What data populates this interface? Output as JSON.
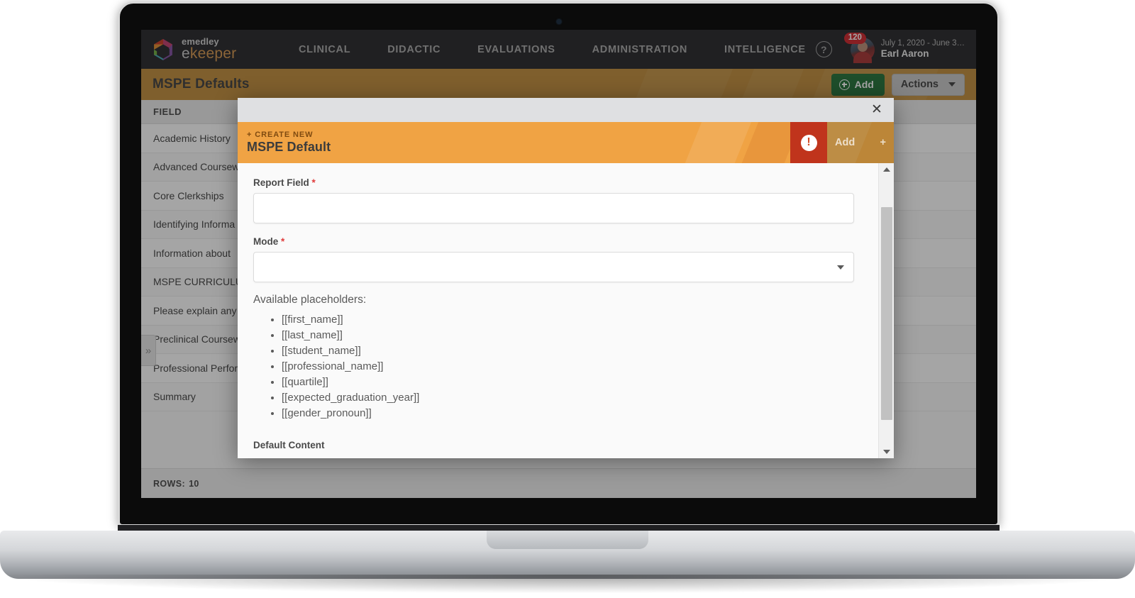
{
  "topnav": {
    "brand": {
      "line1": "emedley",
      "line2_prefix": "e",
      "line2_suffix": "keeper",
      "logo_icon": "hexagon-logo-icon"
    },
    "items": [
      {
        "label": "CLINICAL"
      },
      {
        "label": "DIDACTIC"
      },
      {
        "label": "EVALUATIONS"
      },
      {
        "label": "ADMINISTRATION"
      },
      {
        "label": "INTELLIGENCE"
      }
    ],
    "help_icon": "question-mark-circle-icon",
    "help_glyph": "?",
    "user": {
      "badge_count": "120",
      "date_range": "July 1, 2020 - June 3…",
      "name": "Earl Aaron",
      "avatar_icon": "user-avatar"
    }
  },
  "page_header": {
    "title": "MSPE Defaults",
    "add_label": "Add",
    "add_icon": "plus-circle-icon",
    "actions_label": "Actions",
    "actions_caret_icon": "chevron-down-icon",
    "bg_color": "#c08b38",
    "add_color": "#1f6f34"
  },
  "table": {
    "columns": [
      "FIELD"
    ],
    "rows": [
      {
        "field": "Academic History"
      },
      {
        "field": "Advanced Coursew"
      },
      {
        "field": "Core Clerkships"
      },
      {
        "field": "Identifying Informa"
      },
      {
        "field": "Information about "
      },
      {
        "field": "MSPE CURRICULUM"
      },
      {
        "field": "Please explain any "
      },
      {
        "field": "Preclinical Coursew"
      },
      {
        "field": "Professional Perforn"
      },
      {
        "field": "Summary"
      }
    ],
    "expand_handle_icon": "chevron-double-right-icon",
    "expand_handle_glyph": "»",
    "footer_label": "ROWS:",
    "footer_count": "10"
  },
  "modal": {
    "close_icon": "close-icon",
    "close_glyph": "✕",
    "eyebrow": "+ CREATE NEW",
    "title": "MSPE Default",
    "warning_icon": "exclamation-circle-icon",
    "warning_glyph": "!",
    "add_label": "Add",
    "add_plus_glyph": "+",
    "header_color": "#f0a344",
    "warning_color": "#c0341c",
    "fields": {
      "report_field": {
        "label": "Report Field",
        "required_marker": "*",
        "value": "",
        "placeholder": ""
      },
      "mode": {
        "label": "Mode",
        "required_marker": "*",
        "value": "",
        "placeholder": "",
        "caret_icon": "chevron-down-icon"
      }
    },
    "placeholders_title": "Available placeholders:",
    "placeholders": [
      "[[first_name]]",
      "[[last_name]]",
      "[[student_name]]",
      "[[professional_name]]",
      "[[quartile]]",
      "[[expected_graduation_year]]",
      "[[gender_pronoun]]"
    ],
    "default_content_label": "Default Content",
    "scrollbar": {
      "up_icon": "scroll-up-arrow-icon",
      "down_icon": "scroll-down-arrow-icon"
    }
  }
}
